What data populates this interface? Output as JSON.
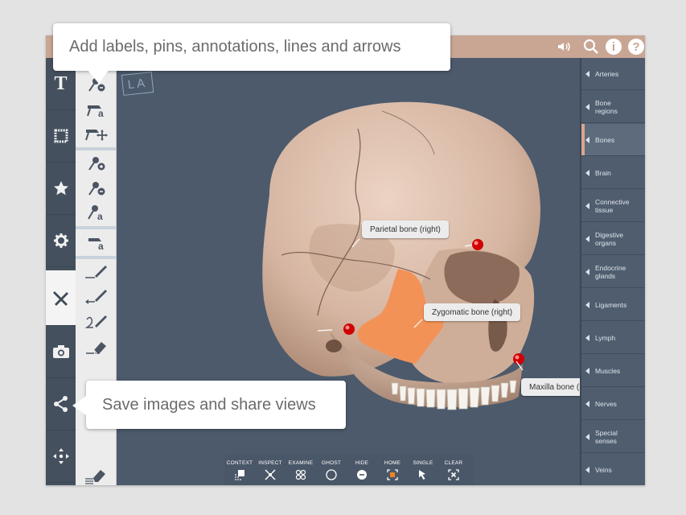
{
  "callouts": {
    "annotate": "Add labels, pins, annotations, lines and arrows",
    "share": "Save images and share views"
  },
  "toolbar": {
    "tools": [
      "text-icon",
      "stamp-icon",
      "star-icon",
      "gear-icon",
      "annotate-icon",
      "camera-icon",
      "share-icon",
      "move-icon"
    ],
    "active_tool": "annotate-icon",
    "text_tool_glyph": "T"
  },
  "top_icons": [
    "sound-icon",
    "search-icon",
    "info-icon",
    "help-icon"
  ],
  "logo_text": "LA",
  "systems": [
    "Arteries",
    "Bone regions",
    "Bones",
    "Brain",
    "Connective tissue",
    "Digestive organs",
    "Endocrine glands",
    "Ligaments",
    "Lymph",
    "Muscles",
    "Nerves",
    "Special senses",
    "Veins"
  ],
  "active_system": "Bones",
  "labels": {
    "parietal": "Parietal bone (right)",
    "zygomatic": "Zygomatic bone (right)",
    "maxilla": "Maxilla bone (left)"
  },
  "bottom_tools": [
    "CONTEXT",
    "INSPECT",
    "EXAMINE",
    "GHOST",
    "HIDE",
    "HOME",
    "SINGLE",
    "CLEAR"
  ],
  "colors": {
    "accent": "#c9a594",
    "highlight": "#f39257",
    "bone": "#d8bcaa",
    "pin": "#d10000",
    "home_active": "#f0831e"
  }
}
